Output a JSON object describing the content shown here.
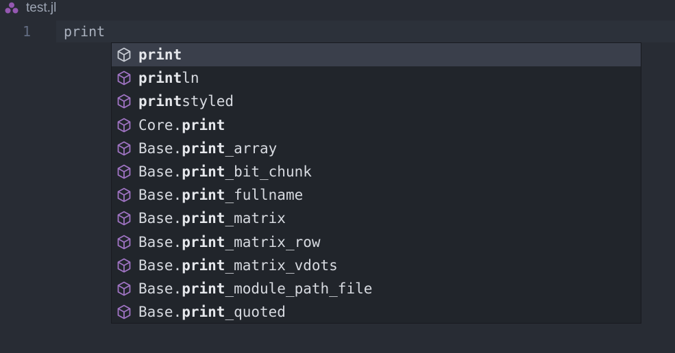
{
  "tab": {
    "title": "test.jl",
    "icon": "julia-dots-icon",
    "icon_colors": [
      "#9558b2",
      "#9558b2",
      "#9558b2"
    ]
  },
  "editor": {
    "line_number": "1",
    "code": "print"
  },
  "autocomplete": {
    "icon": "cube-icon",
    "icon_color": "#a074c4",
    "items": [
      {
        "prefix": "",
        "match": "print",
        "suffix": "",
        "selected": true
      },
      {
        "prefix": "",
        "match": "print",
        "suffix": "ln",
        "selected": false
      },
      {
        "prefix": "",
        "match": "print",
        "suffix": "styled",
        "selected": false
      },
      {
        "prefix": "Core.",
        "match": "print",
        "suffix": "",
        "selected": false
      },
      {
        "prefix": "Base.",
        "match": "print",
        "suffix": "_array",
        "selected": false
      },
      {
        "prefix": "Base.",
        "match": "print",
        "suffix": "_bit_chunk",
        "selected": false
      },
      {
        "prefix": "Base.",
        "match": "print",
        "suffix": "_fullname",
        "selected": false
      },
      {
        "prefix": "Base.",
        "match": "print",
        "suffix": "_matrix",
        "selected": false
      },
      {
        "prefix": "Base.",
        "match": "print",
        "suffix": "_matrix_row",
        "selected": false
      },
      {
        "prefix": "Base.",
        "match": "print",
        "suffix": "_matrix_vdots",
        "selected": false
      },
      {
        "prefix": "Base.",
        "match": "print",
        "suffix": "_module_path_file",
        "selected": false
      },
      {
        "prefix": "Base.",
        "match": "print",
        "suffix": "_quoted",
        "selected": false
      }
    ]
  }
}
